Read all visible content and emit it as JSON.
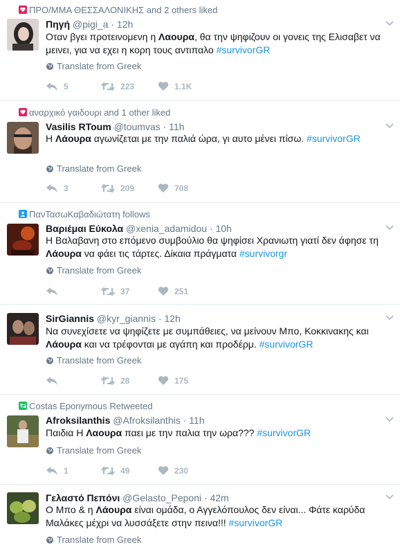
{
  "translate_label": "Translate from Greek",
  "tweets": [
    {
      "context": "ΠΡΟ/ΜΜΑ ΘΕΣΣΑΛΟΝΙΚΗΣ and 2 others liked",
      "context_icon": "heart-icon",
      "fullname": "Πηγή",
      "username": "@pigi_a",
      "time": "12h",
      "text_parts": [
        "Οταν βγει προτεινομενη η ",
        "Λαουρα",
        ", θα την ψηφιζουν οι γονεις της Ελισαβετ να μεινει, για να εχει η κορη τους αντιπαλο ",
        "#survivorGR"
      ],
      "replies": "5",
      "retweets": "223",
      "likes": "1.1K"
    },
    {
      "context": "αναρχικό γαιδουρι and 1 other liked",
      "context_icon": "heart-icon",
      "fullname": "Vasilis RToum",
      "username": "@toumvas",
      "time": "11h",
      "text_parts": [
        "Η ",
        "Λάουρα",
        " αγωνίζεται με την παλιά ώρα, γι αυτο μένει πίσω. ",
        "#survivorGR"
      ],
      "replies": "3",
      "retweets": "209",
      "likes": "708"
    },
    {
      "context": "ΠανΤασωΚαβαδιώτατη follows",
      "context_icon": "person-icon",
      "fullname": "Βαριέμαι Εύκολα",
      "username": "@xenia_adamidou",
      "time": "10h",
      "text_parts": [
        "Η Βαλαβανη στο επόμενο συμβούλιο θα ψηφίσει Χρανιωτη γιατί δεν άφησε τη ",
        "Λάουρα",
        " να φάει τις τάρτες. Δίκαια πράγματα ",
        "#survivorgr"
      ],
      "replies": "",
      "retweets": "37",
      "likes": "251"
    },
    {
      "context": "",
      "context_icon": "",
      "fullname": "SirGiannis",
      "username": "@kyr_giannis",
      "time": "12h",
      "text_parts": [
        "Να συνεχίσετε να ψηφίζετε με συμπάθειες, να μείνουν Μπο, Κοκκινακης και ",
        "Λάουρα",
        " και να τρέφονται με αγάπη και προδέρμ. ",
        "#survivorGR"
      ],
      "replies": "",
      "retweets": "28",
      "likes": "175"
    },
    {
      "context": "Costas Eponymous Retweeted",
      "context_icon": "retweet-icon",
      "fullname": "Afroksilanthis",
      "username": "@Afroksilanthis",
      "time": "11h",
      "text_parts": [
        "Παιδια Η ",
        "Λαουρα",
        " παει με την παλια την ωρα??? ",
        "#survivorGR"
      ],
      "replies": "1",
      "retweets": "49",
      "likes": "230"
    },
    {
      "context": "",
      "context_icon": "",
      "fullname": "Γελαστό Πεπόνι",
      "username": "@Gelasto_Peponi",
      "time": "42m",
      "text_parts": [
        "Ο Μπο & η ",
        "Λάουρα",
        " είναι ομάδα, ο Αγγελόπουλος δεν είναι... Φάτε καρύδα Μαλάκες μέχρι να λυσσάξετε στην πεινα!!! ",
        "#survivorGR"
      ],
      "replies": "",
      "retweets": "",
      "likes": ""
    }
  ]
}
